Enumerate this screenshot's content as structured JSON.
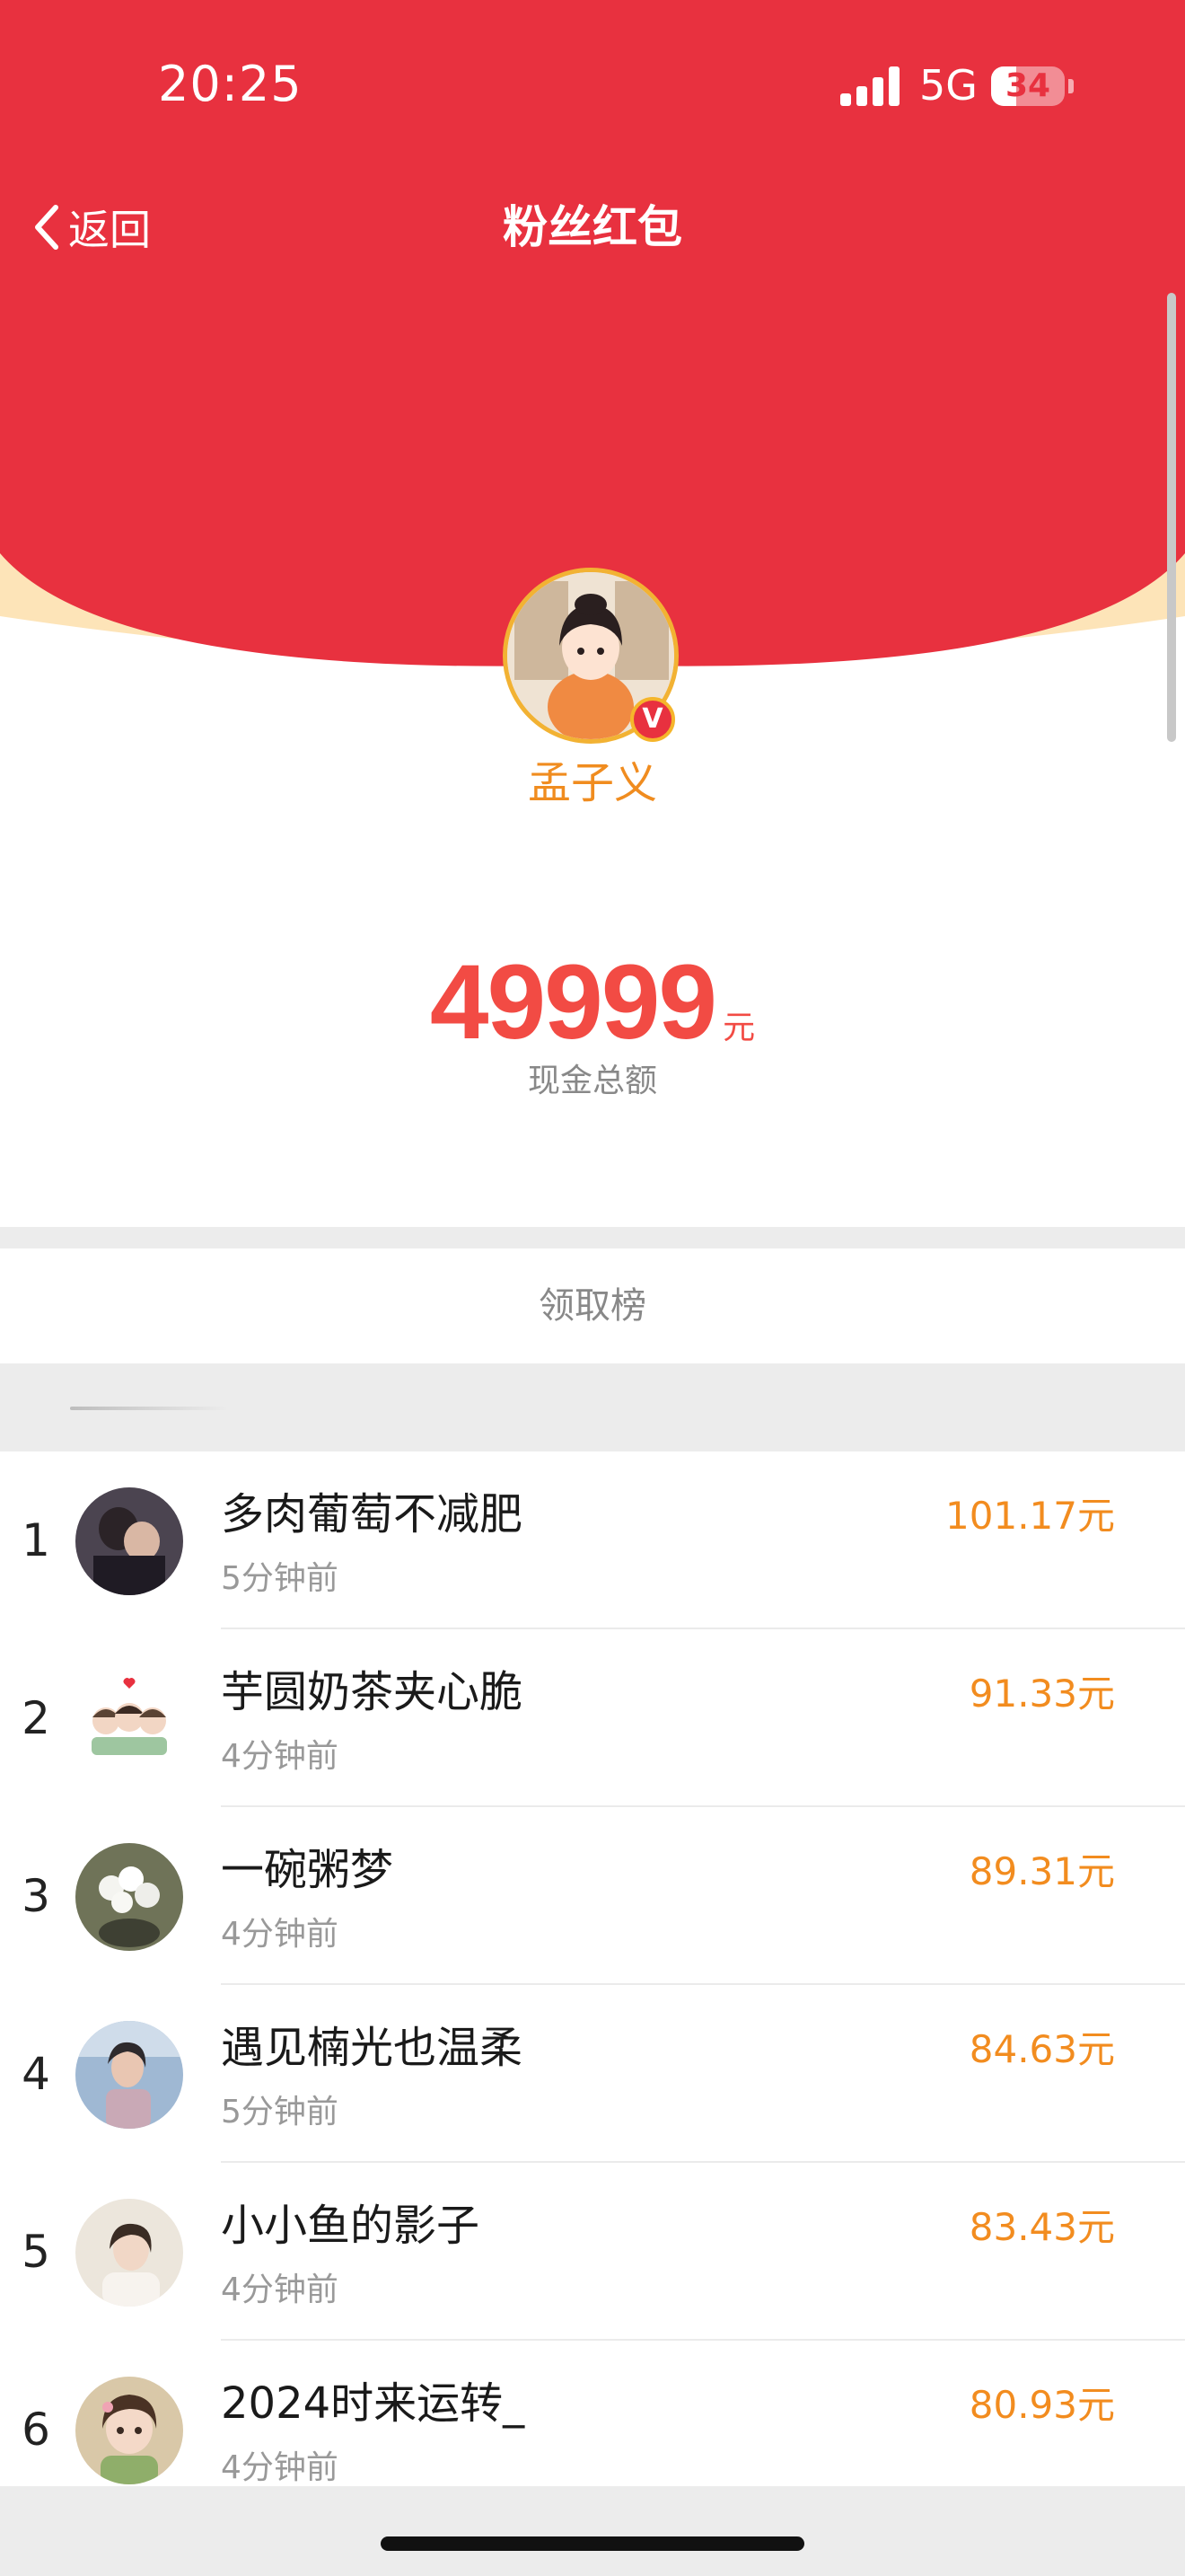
{
  "status_bar": {
    "time": "20:25",
    "network": "5G",
    "battery": "34",
    "battery_level": 0.34
  },
  "nav": {
    "back_label": "返回",
    "title": "粉丝红包"
  },
  "owner": {
    "name": "孟子义",
    "verified_mark": "V"
  },
  "summary": {
    "amount": "49999",
    "unit": "元",
    "label": "现金总额"
  },
  "list_title": "领取榜",
  "colors": {
    "header_red": "#e8313f",
    "accent_orange": "#f28c1f",
    "amount_red": "#f24b44",
    "rim_cream": "#fde4b8"
  },
  "ranking": [
    {
      "rank": "1",
      "name": "多肉葡萄不减肥",
      "time": "5分钟前",
      "amount": "101.17元"
    },
    {
      "rank": "2",
      "name": "芋圆奶茶夹心脆",
      "time": "4分钟前",
      "amount": "91.33元"
    },
    {
      "rank": "3",
      "name": "一碗粥梦",
      "time": "4分钟前",
      "amount": "89.31元"
    },
    {
      "rank": "4",
      "name": "遇见楠光也温柔",
      "time": "5分钟前",
      "amount": "84.63元"
    },
    {
      "rank": "5",
      "name": "小小鱼的影子",
      "time": "4分钟前",
      "amount": "83.43元"
    },
    {
      "rank": "6",
      "name": "2024时来运转_",
      "time": "4分钟前",
      "amount": "80.93元"
    }
  ]
}
